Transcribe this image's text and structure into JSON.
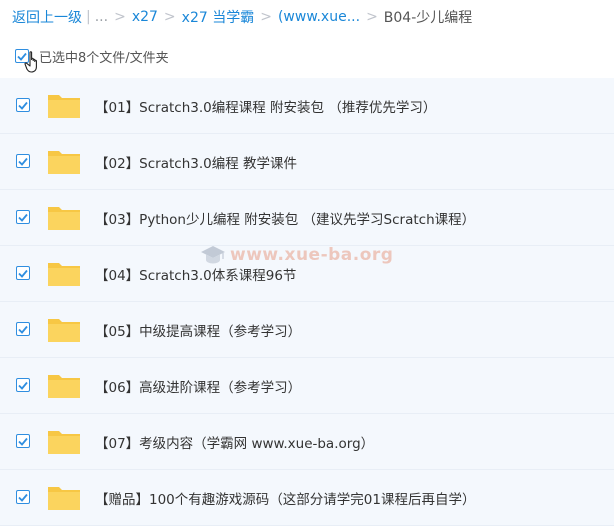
{
  "breadcrumb": {
    "back": "返回上一级",
    "pipe": "|",
    "ellipsis": "...",
    "sep": ">",
    "items": [
      "x27",
      "x27 当学霸",
      "(www.xue..."
    ],
    "current": "B04-少儿编程"
  },
  "selection": {
    "label": "已选中8个文件/文件夹"
  },
  "files": [
    {
      "name": "【01】Scratch3.0编程课程 附安装包 （推荐优先学习）"
    },
    {
      "name": "【02】Scratch3.0编程 教学课件"
    },
    {
      "name": "【03】Python少儿编程 附安装包 （建议先学习Scratch课程）"
    },
    {
      "name": "【04】Scratch3.0体系课程96节"
    },
    {
      "name": "【05】中级提高课程（参考学习）"
    },
    {
      "name": "【06】高级进阶课程（参考学习）"
    },
    {
      "name": "【07】考级内容（学霸网 www.xue-ba.org）"
    },
    {
      "name": "【赠品】100个有趣游戏源码（这部分请学完01课程后再自学）"
    }
  ],
  "watermark": {
    "text": "www.xue-ba.org"
  },
  "colors": {
    "accent": "#1a87d8",
    "checkbox": "#2f8ee0",
    "folder": "#f7c744",
    "row_bg": "#f4f8fd"
  },
  "icons": {
    "checkbox": "checkmark-icon",
    "folder": "folder-icon",
    "cursor": "hand-pointer-icon",
    "watermark": "graduation-cap-icon"
  }
}
